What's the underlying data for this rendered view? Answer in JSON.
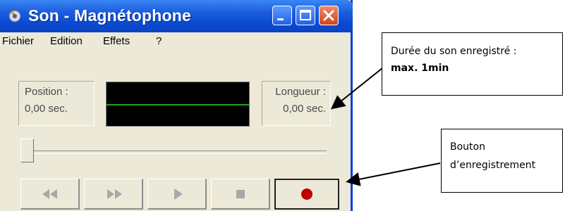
{
  "window": {
    "title": "Son - Magnétophone",
    "title_bar_color": "#0b4bd3",
    "icon": "recorder-app-icon"
  },
  "menu": {
    "items": [
      "Fichier",
      "Edition",
      "Effets",
      "?"
    ]
  },
  "position": {
    "label": "Position :",
    "value": "0,00 sec."
  },
  "length": {
    "label": "Longueur :",
    "value": "0,00 sec."
  },
  "controls": {
    "buttons": [
      "rewind-icon",
      "fast-forward-icon",
      "play-icon",
      "stop-icon",
      "record-icon"
    ],
    "record_color": "#c00000"
  },
  "annotations": {
    "duration": {
      "line1": "Durée du son enregistré :",
      "line2": "max. 1min"
    },
    "record_button": {
      "line1": "Bouton",
      "line2": "d’enregistrement"
    }
  }
}
